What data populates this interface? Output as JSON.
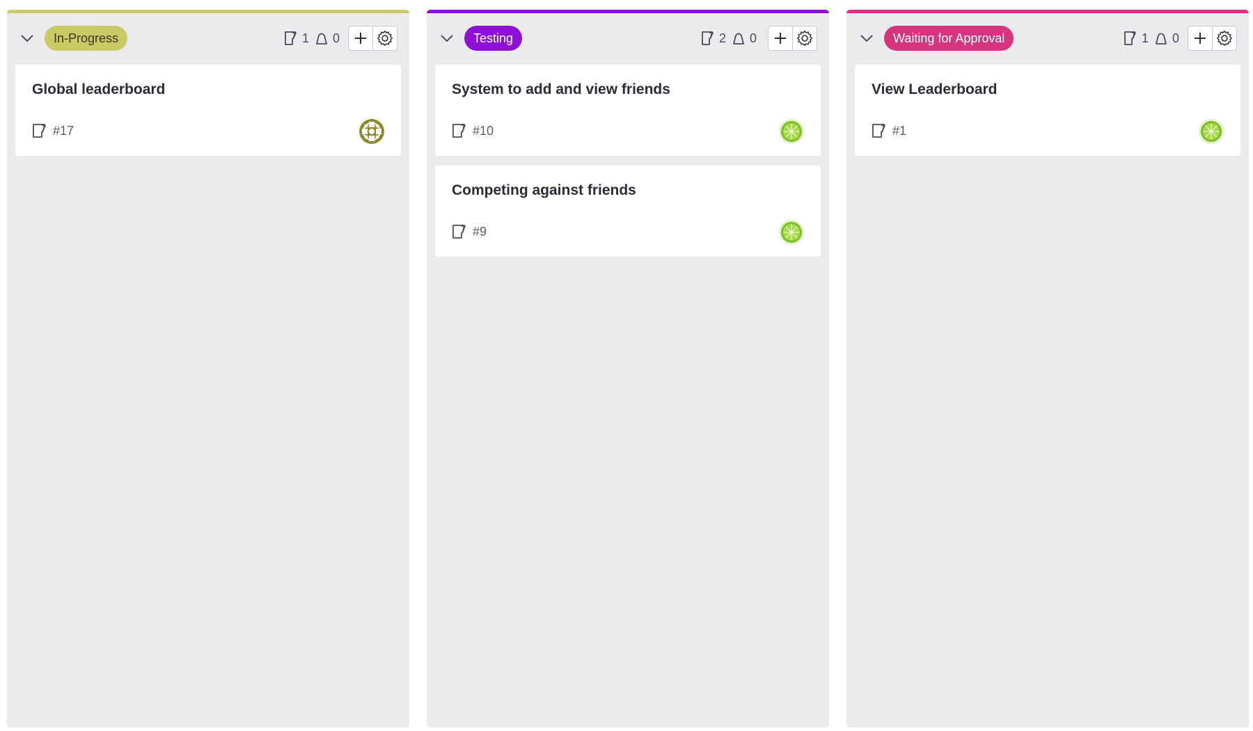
{
  "columns": [
    {
      "name": "In-Progress",
      "color": "#c9c966",
      "tag_text_color": "#3a3a1a",
      "story_count": "1",
      "task_count": "0",
      "cards": [
        {
          "title": "Global leaderboard",
          "ref": "#17",
          "avatar": "olive-pattern-avatar"
        }
      ]
    },
    {
      "name": "Testing",
      "color": "#8e0fd6",
      "tag_text_color": "#ffffff",
      "story_count": "2",
      "task_count": "0",
      "cards": [
        {
          "title": "System to add and view friends",
          "ref": "#10",
          "avatar": "lime-avatar"
        },
        {
          "title": "Competing against friends",
          "ref": "#9",
          "avatar": "lime-avatar"
        }
      ]
    },
    {
      "name": "Waiting for Approval",
      "color": "#d6347f",
      "tag_text_color": "#ffffff",
      "story_count": "1",
      "task_count": "0",
      "cards": [
        {
          "title": "View Leaderboard",
          "ref": "#1",
          "avatar": "lime-avatar"
        }
      ]
    }
  ],
  "icons": {
    "collapse": "chevron-down-icon",
    "story": "user-story-icon",
    "task": "task-icon",
    "add": "plus-icon",
    "settings": "gear-icon"
  }
}
